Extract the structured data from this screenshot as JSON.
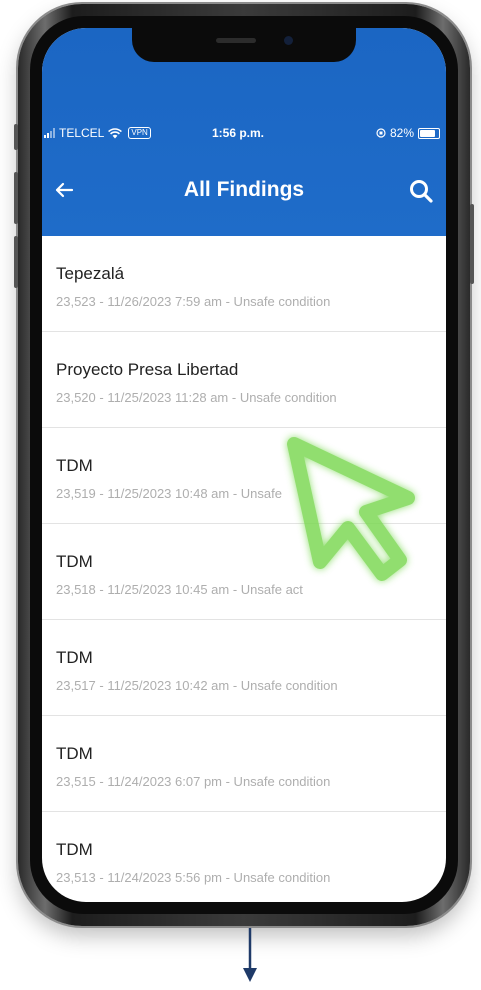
{
  "status_bar": {
    "carrier": "TELCEL",
    "vpn": "VPN",
    "time": "1:56 p.m.",
    "battery_text": "82%",
    "battery_level": 0.82
  },
  "header": {
    "title": "All Findings"
  },
  "findings": [
    {
      "name": "Tepezalá",
      "meta": "23,523 - 11/26/2023 7:59 am - Unsafe condition"
    },
    {
      "name": "Proyecto Presa Libertad",
      "meta": "23,520 - 11/25/2023 11:28 am - Unsafe condition"
    },
    {
      "name": "TDM",
      "meta": "23,519 - 11/25/2023 10:48 am - Unsafe"
    },
    {
      "name": "TDM",
      "meta": "23,518 - 11/25/2023 10:45 am - Unsafe act"
    },
    {
      "name": "TDM",
      "meta": "23,517 - 11/25/2023 10:42 am - Unsafe condition"
    },
    {
      "name": "TDM",
      "meta": "23,515 - 11/24/2023 6:07 pm - Unsafe condition"
    },
    {
      "name": "TDM",
      "meta": "23,513 - 11/24/2023 5:56 pm - Unsafe condition"
    }
  ],
  "colors": {
    "appbar": "#1f6cc9",
    "cursor_outline": "#7ed957"
  },
  "icons": {
    "back": "back-arrow-icon",
    "search": "search-icon",
    "cursor": "pointer-cursor-icon",
    "scroll": "down-arrow-icon"
  }
}
